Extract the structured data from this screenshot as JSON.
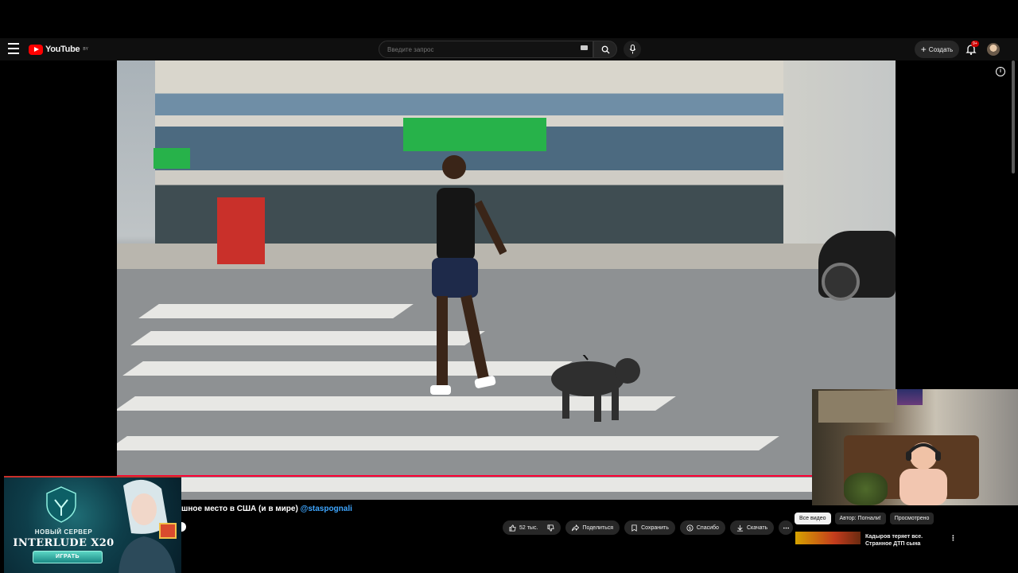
{
  "header": {
    "logo_text": "YouTube",
    "region_code": "BY",
    "search_placeholder": "Введите запрос",
    "create_label": "Создать",
    "notifications_badge": "9+"
  },
  "video": {
    "title_visible": "шное место в США (и в мире)",
    "channel_handle": "@staspognali",
    "progress": 0.893
  },
  "actions": {
    "likes": "52 тыс.",
    "share": "Поделиться",
    "save": "Сохранить",
    "thanks": "Спасибо",
    "download": "Скачать"
  },
  "chips": [
    {
      "label": "Все видео",
      "active": true
    },
    {
      "label": "Автор: Погнали!",
      "active": false
    },
    {
      "label": "Просмотрено",
      "active": false
    }
  ],
  "related": {
    "title": "Кадыров теряет все. Странное ДТП сына"
  },
  "ad": {
    "line1": "НОВЫЙ СЕРВЕР",
    "line2": "INTERLUDE X20",
    "button": "ИГРАТЬ"
  },
  "colors": {
    "accent_red": "#ff0033",
    "link_blue": "#3ea6ff",
    "topbar_bg": "#0f0f0f",
    "bank_green": "#27b24a"
  },
  "icons": [
    "menu-icon",
    "youtube-logo-icon",
    "keyboard-icon",
    "search-icon",
    "mic-icon",
    "plus-icon",
    "bell-icon",
    "info-icon",
    "like-icon",
    "dislike-icon",
    "share-icon",
    "save-icon",
    "thanks-icon",
    "download-icon",
    "more-icon"
  ]
}
